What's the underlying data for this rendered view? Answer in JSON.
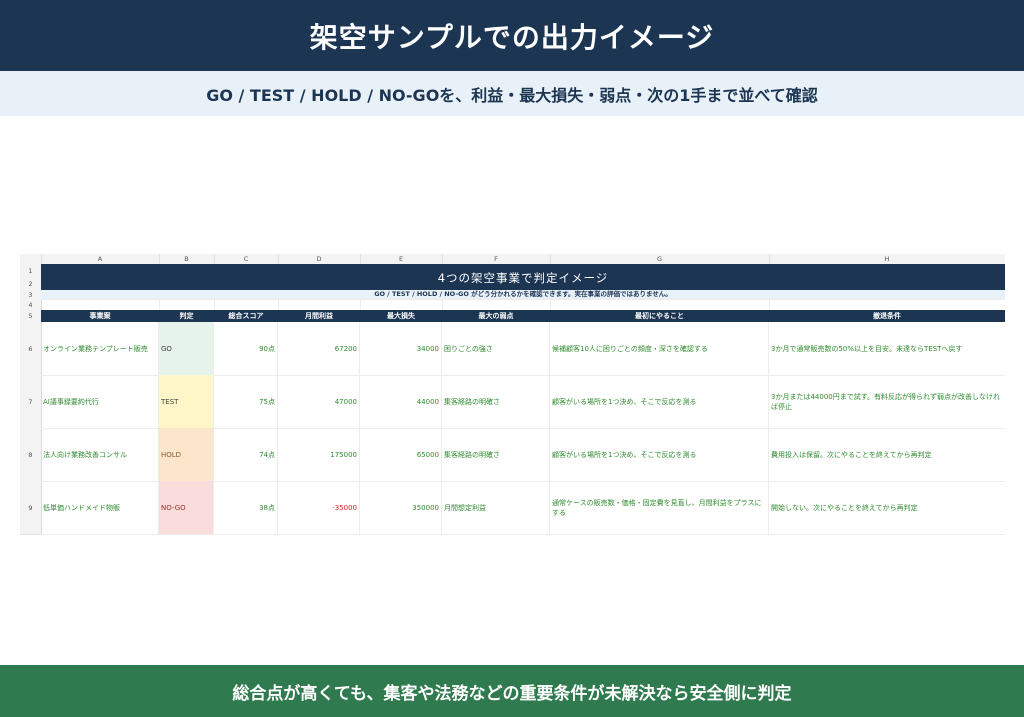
{
  "header": {
    "title": "架空サンプルでの出力イメージ",
    "subtitle": "GO / TEST / HOLD / NO-GOを、利益・最大損失・弱点・次の1手まで並べて確認"
  },
  "footer": {
    "text": "総合点が高くても、集客や法務などの重要条件が未解決なら安全側に判定"
  },
  "sheet": {
    "column_letters": [
      "A",
      "B",
      "C",
      "D",
      "E",
      "F",
      "G",
      "H"
    ],
    "row_numbers": [
      "1",
      "2",
      "3",
      "4",
      "5",
      "6",
      "7",
      "8",
      "9"
    ],
    "title": "4つの架空事業で判定イメージ",
    "note": "GO / TEST / HOLD / NO-GO がどう分かれるかを確認できます。実在事業の評価ではありません。",
    "headers": [
      "事業案",
      "判定",
      "総合スコア",
      "月間利益",
      "最大損失",
      "最大の弱点",
      "最初にやること",
      "撤退条件"
    ],
    "rows": [
      {
        "name": "オンライン業務テンプレート販売",
        "verdict": "GO",
        "score": "90点",
        "profit": "67200",
        "max_loss": "34000",
        "weakness": "困りごとの強さ",
        "first_step": "候補顧客10人に困りごとの頻度・深さを確認する",
        "exit": "3か月で通常販売数の50%以上を目安。未達ならTESTへ戻す"
      },
      {
        "name": "AI議事録要約代行",
        "verdict": "TEST",
        "score": "75点",
        "profit": "47000",
        "max_loss": "44000",
        "weakness": "集客経路の明確さ",
        "first_step": "顧客がいる場所を1つ決め、そこで反応を測る",
        "exit": "3か月または44000円まで試す。有料反応が得られず弱点が改善しなければ停止"
      },
      {
        "name": "法人向け業務改善コンサル",
        "verdict": "HOLD",
        "score": "74点",
        "profit": "175000",
        "max_loss": "65000",
        "weakness": "集客経路の明確さ",
        "first_step": "顧客がいる場所を1つ決め、そこで反応を測る",
        "exit": "費用投入は保留。次にやることを終えてから再判定"
      },
      {
        "name": "低単価ハンドメイド物販",
        "verdict": "NO-GO",
        "score": "38点",
        "profit": "-35000",
        "max_loss": "350000",
        "weakness": "月間想定利益",
        "first_step": "通常ケースの販売数・価格・固定費を見直し、月間利益をプラスにする",
        "exit": "開始しない。次にやることを終えてから再判定"
      }
    ]
  },
  "colors": {
    "navy": "#1b3553",
    "footer_green": "#2f7a4e",
    "text_green": "#2e8b2e",
    "negative_red": "#d42020",
    "verdict_go": "#e6f3ea",
    "verdict_test": "#fdf6c8",
    "verdict_hold": "#fbe6cc",
    "verdict_nogo": "#fadcdc"
  }
}
